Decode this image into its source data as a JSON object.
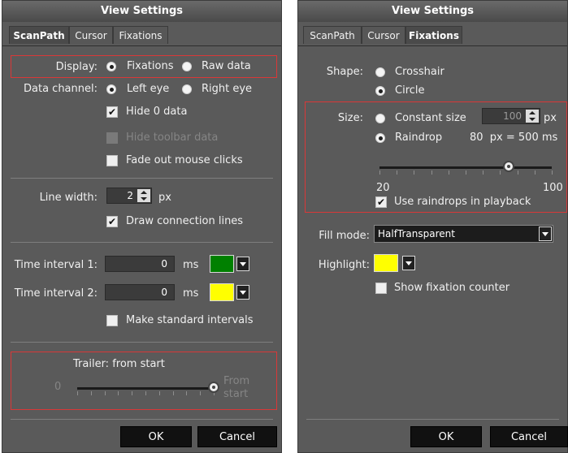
{
  "left": {
    "title": "View Settings",
    "tabs": [
      "ScanPath",
      "Cursor",
      "Fixations"
    ],
    "display": {
      "label": "Display:",
      "options": [
        "Fixations",
        "Raw data"
      ],
      "selected": 0
    },
    "data_channel": {
      "label": "Data channel:",
      "options": [
        "Left eye",
        "Right eye"
      ],
      "selected": 0
    },
    "checks": [
      {
        "label": "Hide 0 data",
        "checked": true,
        "enabled": true
      },
      {
        "label": "Hide toolbar data",
        "checked": false,
        "enabled": false
      },
      {
        "label": "Fade out mouse clicks",
        "checked": false,
        "enabled": true
      }
    ],
    "line_width": {
      "label": "Line width:",
      "value": "2",
      "unit": "px"
    },
    "draw_lines": {
      "label": "Draw connection lines",
      "checked": true
    },
    "ti1": {
      "label": "Time interval 1:",
      "value": "0",
      "unit": "ms",
      "color": "#008000"
    },
    "ti2": {
      "label": "Time interval 2:",
      "value": "0",
      "unit": "ms",
      "color": "#ffff00"
    },
    "make_standard": {
      "label": "Make standard intervals",
      "checked": false
    },
    "trailer": {
      "label": "Trailer: from start",
      "min_label": "0",
      "max_label_1": "From",
      "max_label_2": "start",
      "value_fraction": 1.0
    },
    "ok": "OK",
    "cancel": "Cancel"
  },
  "right": {
    "title": "View Settings",
    "tabs": [
      "ScanPath",
      "Cursor",
      "Fixations"
    ],
    "shape": {
      "label": "Shape:",
      "options": [
        "Crosshair",
        "Circle"
      ],
      "selected": 1
    },
    "size": {
      "label": "Size:",
      "constant_label": "Constant size",
      "constant_value": "100",
      "constant_unit": "px",
      "raindrop_label": "Raindrop",
      "raindrop_text": "80  px = 500 ms",
      "selected": 1
    },
    "slider": {
      "min": "20",
      "max": "100",
      "value": 80
    },
    "use_raindrops": {
      "label": "Use raindrops in playback",
      "checked": true
    },
    "fill_mode": {
      "label": "Fill mode:",
      "value": "HalfTransparent"
    },
    "highlight": {
      "label": "Highlight:",
      "color": "#ffff00"
    },
    "show_counter": {
      "label": "Show fixation counter",
      "checked": false
    },
    "ok": "OK",
    "cancel": "Cancel"
  },
  "icons": {
    "check": "✔"
  }
}
